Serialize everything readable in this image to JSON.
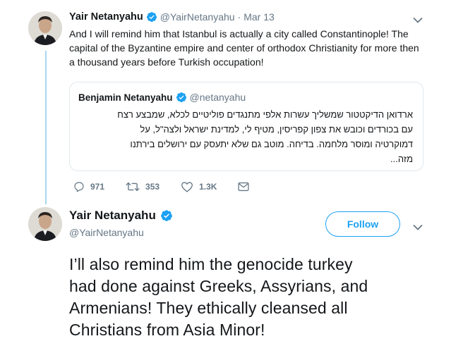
{
  "colors": {
    "accent": "#1da1f2",
    "thread_line": "#a7d7ef",
    "secondary_text": "#657786",
    "primary_text": "#14171a",
    "border": "#e1e8ed"
  },
  "parent_tweet": {
    "author_name": "Yair Netanyahu",
    "handle": "@YairNetanyahu",
    "separator": "·",
    "date": "Mar 13",
    "verified_icon": "verified-badge-icon",
    "text_lines": [
      "And I will remind him that Istanbul is actually a city called Constantinople! The",
      "capital of the Byzantine empire and center of orthodox Christianity for more then",
      "a thousand years before Turkish occupation!"
    ],
    "quoted_tweet": {
      "author_name": "Benjamin Netanyahu",
      "handle": "@netanyahu",
      "text_lines": [
        "ארדואן הדיקטטור שמשליך עשרות אלפי מתנגדים פוליטיים לכלא, שמבצע רצח",
        "עם בכורדים וכובש את צפון קפריסין, מטיף לי, למדינת ישראל ולצה\"ל, על",
        "דמוקרטיה ומוסר מלחמה. בדיחה. מוטב גם שלא יתעסק עם ירושלים בירתנו",
        "מזה..."
      ]
    },
    "actions": {
      "replies": "971",
      "retweets": "353",
      "likes": "1.3K"
    }
  },
  "reply_tweet": {
    "author_name": "Yair Netanyahu",
    "handle": "@YairNetanyahu",
    "follow_label": "Follow",
    "text_lines": [
      "I’ll also remind him the genocide turkey",
      "had done against Greeks, Assyrians, and",
      "Armenians! They ethically cleansed all",
      "Christians from Asia Minor!"
    ]
  }
}
